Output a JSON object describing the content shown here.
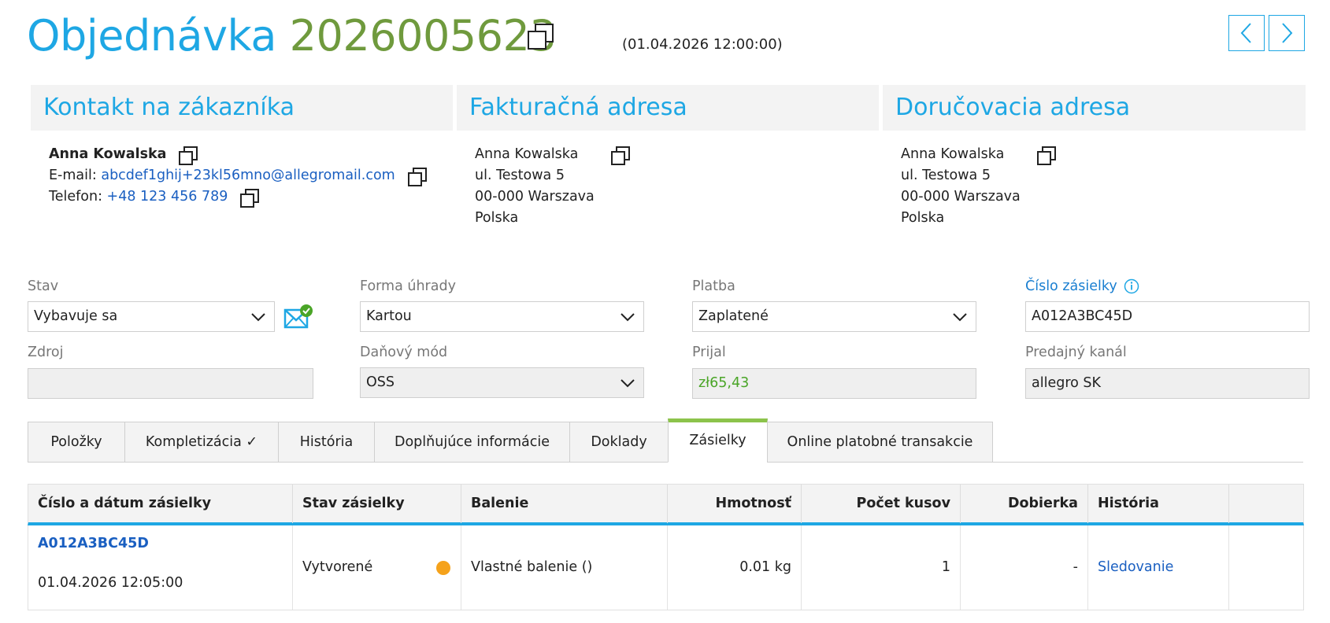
{
  "header": {
    "title_word": "Objednávka",
    "order_number": "2026005623",
    "order_datetime": "(01.04.2026 12:00:00)"
  },
  "colors": {
    "accent_blue": "#1ea7e4",
    "order_green": "#6f9a3d",
    "link_blue": "#1a5fc1",
    "tab_active_green": "#8cc34b",
    "status_orange": "#f5a21b",
    "amount_green": "#4aa527"
  },
  "customer": {
    "heading": "Kontakt na zákazníka",
    "name": "Anna Kowalska",
    "email_label": "E-mail:",
    "email": "abcdef1ghij+23kl56mno@allegromail.com",
    "phone_label": "Telefon:",
    "phone": "+48 123 456 789"
  },
  "billing": {
    "heading": "Fakturačná adresa",
    "lines": [
      "Anna Kowalska",
      "ul. Testowa 5",
      "00-000 Warszava",
      "Polska"
    ]
  },
  "shipping": {
    "heading": "Doručovacia adresa",
    "lines": [
      "Anna Kowalska",
      "ul. Testowa 5",
      "00-000 Warszava",
      "Polska"
    ]
  },
  "form": {
    "stav": {
      "label": "Stav",
      "value": "Vybavuje sa"
    },
    "forma_uhrady": {
      "label": "Forma úhrady",
      "value": "Kartou"
    },
    "platba": {
      "label": "Platba",
      "value": "Zaplatené"
    },
    "cislo_zasielky": {
      "label": "Číslo zásielky",
      "value": "A012A3BC45D"
    },
    "zdroj": {
      "label": "Zdroj",
      "value": ""
    },
    "danovy_mod": {
      "label": "Daňový mód",
      "value": "OSS"
    },
    "prijal": {
      "label": "Prijal",
      "value": "zł65,43"
    },
    "predajny_kanal": {
      "label": "Predajný kanál",
      "value": "allegro SK"
    }
  },
  "tabs": [
    {
      "label": "Položky"
    },
    {
      "label": "Kompletizácia ✓"
    },
    {
      "label": "História"
    },
    {
      "label": "Doplňujúce informácie"
    },
    {
      "label": "Doklady"
    },
    {
      "label": "Zásielky"
    },
    {
      "label": "Online platobné transakcie"
    }
  ],
  "active_tab": "Zásielky",
  "shipments": {
    "columns": [
      "Číslo a dátum zásielky",
      "Stav zásielky",
      "Balenie",
      "Hmotnosť",
      "Počet kusov",
      "Dobierka",
      "História"
    ],
    "rows": [
      {
        "number": "A012A3BC45D",
        "date": "01.04.2026 12:05:00",
        "status": "Vytvorené",
        "packaging": "Vlastné balenie ()",
        "weight": "0.01 kg",
        "pieces": "1",
        "cod": "-",
        "history_link": "Sledovanie"
      }
    ]
  },
  "icons": {
    "copy": "copy-icon",
    "prev": "chevron-left-icon",
    "next": "chevron-right-icon",
    "dropdown": "chevron-down-icon",
    "email": "envelope-check-icon",
    "info": "info-icon",
    "status": "status-dot-icon"
  }
}
